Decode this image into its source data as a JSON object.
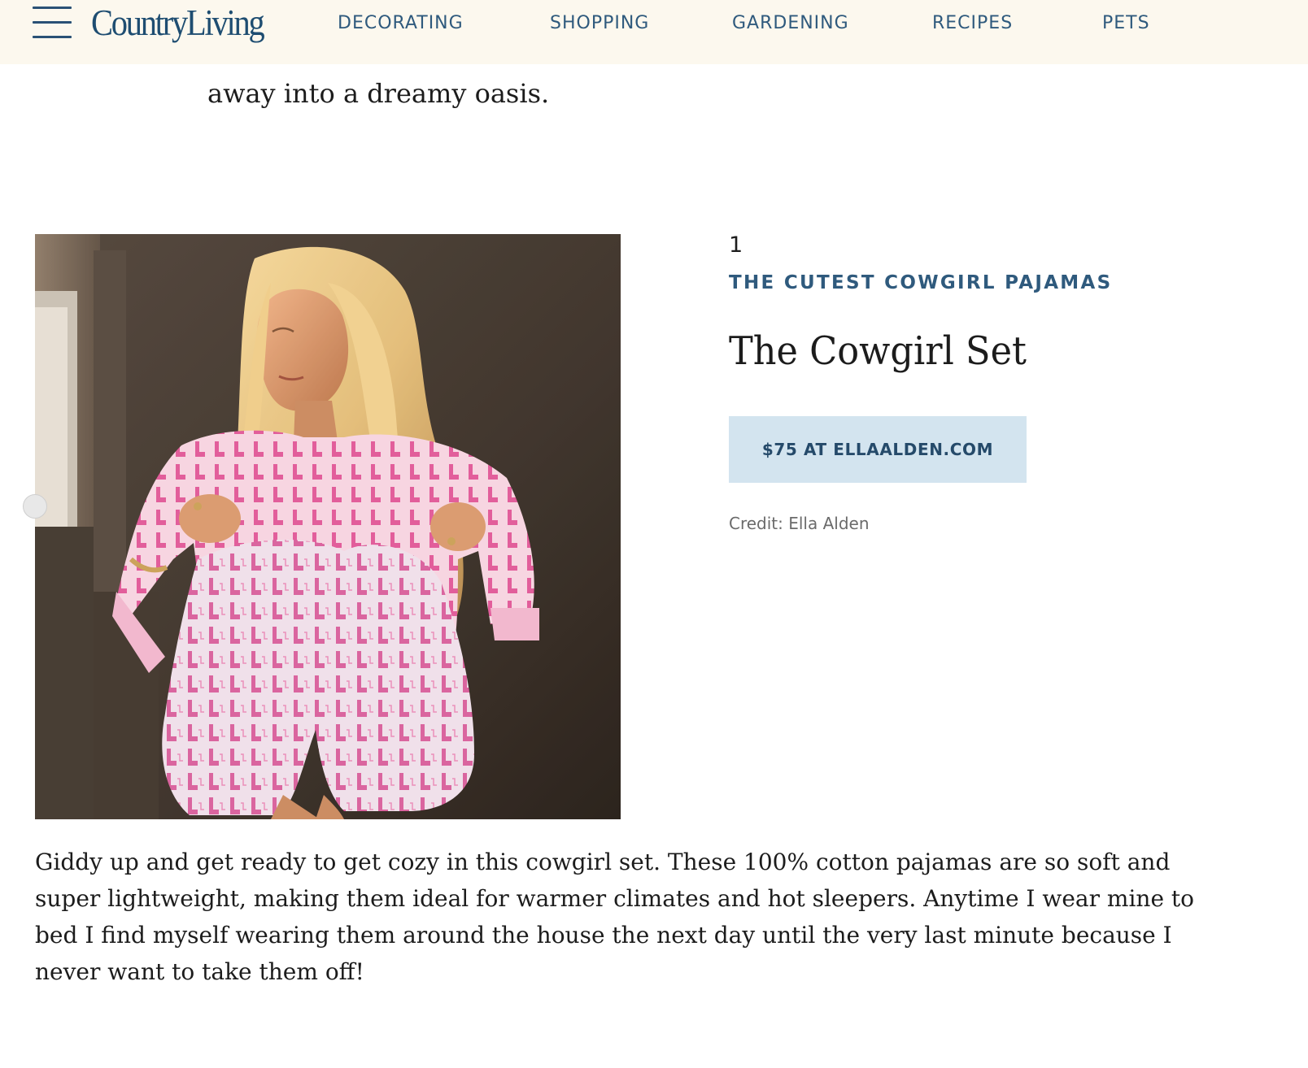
{
  "header": {
    "logo_text": "CountryLiving",
    "nav_items": [
      {
        "label": "DECORATING"
      },
      {
        "label": "SHOPPING"
      },
      {
        "label": "GARDENING"
      },
      {
        "label": "RECIPES"
      },
      {
        "label": "PETS"
      }
    ]
  },
  "article": {
    "intro_text": "away into a dreamy oasis.",
    "product": {
      "number": "1",
      "kicker": "THE CUTEST COWGIRL PAJAMAS",
      "name": "The Cowgirl Set",
      "buy_label": "$75 AT ELLAALDEN.COM",
      "credit": "Credit: Ella Alden",
      "image_alt": "Woman sitting against a stone wall wearing pink cowboy boot print pajamas"
    },
    "description_lines": [
      "Giddy up and get ready to get cozy in this cowgirl set. These 100% cotton pajamas are so soft and",
      "super lightweight, making them ideal for warmer climates and hot sleepers. Anytime I wear mine to",
      "bed I find myself wearing them around the house the next day until the very last minute because I",
      "never want to take them off!"
    ]
  },
  "colors": {
    "header_bg": "#fcf8ee",
    "brand_blue": "#2f5a7d",
    "button_bg": "#d3e4ef",
    "body_text": "#1c1c1c"
  }
}
